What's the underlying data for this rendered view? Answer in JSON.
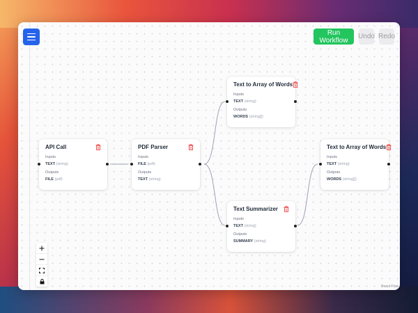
{
  "toolbar": {
    "run_label": "Run Workflow",
    "undo_label": "Undo",
    "redo_label": "Redo"
  },
  "colors": {
    "accent_blue": "#2563eb",
    "run_green": "#22c55e",
    "delete_red": "#ef4444"
  },
  "nodes": {
    "api_call": {
      "title": "API Call",
      "inputs_label": "Inputs",
      "input_name": "TEXT",
      "input_type": "(string)",
      "outputs_label": "Outputs",
      "output_name": "FILE",
      "output_type": "(pdf)"
    },
    "pdf_parser": {
      "title": "PDF Parser",
      "inputs_label": "Inputs",
      "input_name": "FILE",
      "input_type": "(pdf)",
      "outputs_label": "Outputs",
      "output_name": "TEXT",
      "output_type": "(string)"
    },
    "text_to_array_1": {
      "title": "Text to Array of Words",
      "inputs_label": "Inputs",
      "input_name": "TEXT",
      "input_type": "(string)",
      "outputs_label": "Outputs",
      "output_name": "WORDS",
      "output_type": "(string[])"
    },
    "text_summarizer": {
      "title": "Text Summarizer",
      "inputs_label": "Inputs",
      "input_name": "TEXT",
      "input_type": "(string)",
      "outputs_label": "Outputs",
      "output_name": "SUMMARY",
      "output_type": "(string)"
    },
    "text_to_array_2": {
      "title": "Text to Array of Words",
      "inputs_label": "Inputs",
      "input_name": "TEXT",
      "input_type": "(string)",
      "outputs_label": "Outputs",
      "output_name": "WORDS",
      "output_type": "(string[])"
    }
  },
  "controls": {
    "zoom_in_icon": "plus-icon",
    "zoom_out_icon": "minus-icon",
    "fit_view_icon": "fit-view-icon",
    "lock_icon": "lock-icon"
  },
  "attribution": "React Flow"
}
